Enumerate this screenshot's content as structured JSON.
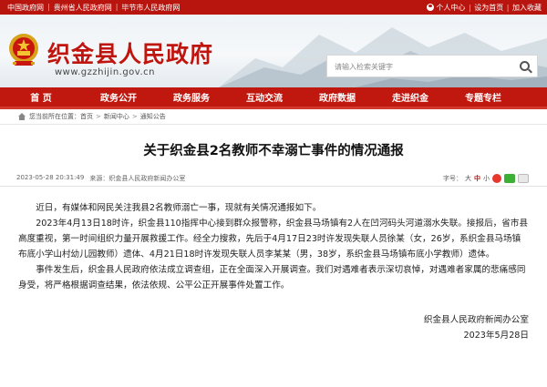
{
  "topbar": {
    "links": [
      "中国政府网",
      "贵州省人民政府网",
      "毕节市人民政府网"
    ],
    "right": [
      "个人中心",
      "设为首页",
      "加入收藏"
    ]
  },
  "header": {
    "title": "织金县人民政府",
    "domain": "www.gzzhijin.gov.cn",
    "search_placeholder": "请输入检索关键字"
  },
  "nav": [
    "首 页",
    "政务公开",
    "政务服务",
    "互动交流",
    "政府数据",
    "走进织金",
    "专题专栏"
  ],
  "breadcrumb": [
    "您当前所在位置：首页",
    "新闻中心",
    "通知公告"
  ],
  "article": {
    "title": "关于织金县2名教师不幸溺亡事件的情况通报",
    "date": "2023-05-28 20:31:49",
    "source": "来源：织金县人民政府新闻办公室",
    "font_label": "字号：",
    "font_sizes": [
      "大",
      "中",
      "小"
    ],
    "paragraphs": [
      "近日，有媒体和网民关注我县2名教师溺亡一事，现就有关情况通报如下。",
      "2023年4月13日18时许，织金县110指挥中心接到群众报警称，织金县马场镇有2人在凹河码头河道溺水失联。接报后，省市县高度重视，第一时间组织力量开展救援工作。经全力搜救，先后于4月17日23时许发现失联人员徐某（女，26岁，系织金县马场镇布底小学山村幼儿园教师）遗体、4月21日18时许发现失联人员李某某（男，38岁，系织金县马场镇布底小学教师）遗体。",
      "事件发生后，织金县人民政府依法成立调查组，正在全面深入开展调查。我们对遇难者表示深切哀悼，对遇难者家属的悲痛感同身受，将严格根据调查结果，依法依规、公平公正开展事件处置工作。"
    ],
    "signature": "织金县人民政府新闻办公室",
    "sign_date": "2023年5月28日"
  }
}
